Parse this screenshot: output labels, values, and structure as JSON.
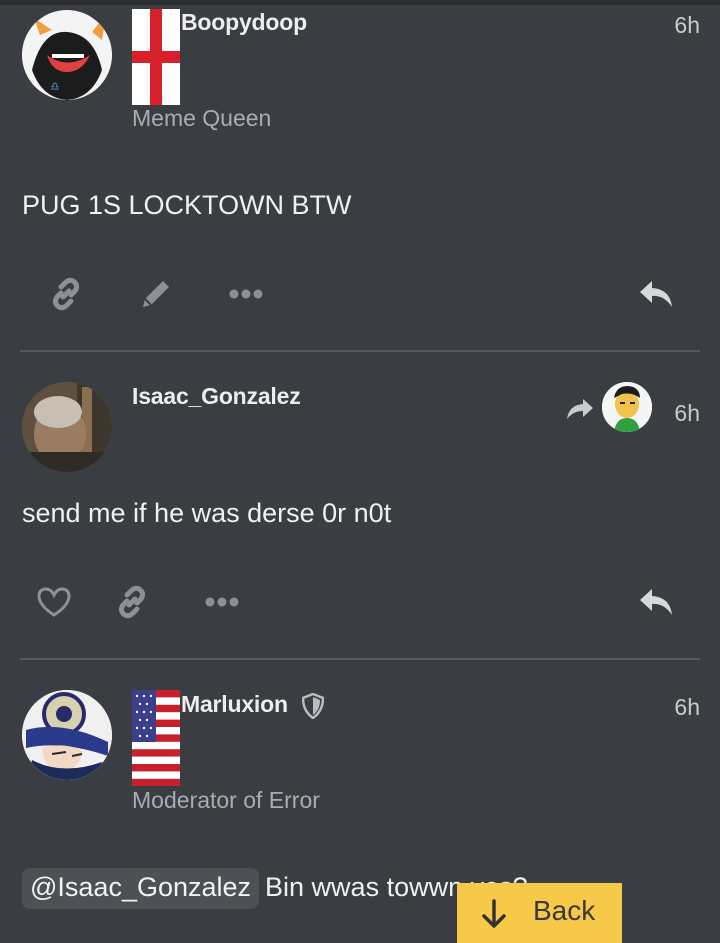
{
  "posts": [
    {
      "username": "Boopydoop",
      "user_title": "Meme Queen",
      "time": "6h",
      "body": "PUG 1S LOCKTOWN BTW",
      "flag": "england"
    },
    {
      "username": "Isaac_Gonzalez",
      "time": "6h",
      "body": "send me if he was derse 0r n0t",
      "reply_to_avatar": "green-shirt-avatar"
    },
    {
      "username": "Marluxion",
      "user_title": "Moderator of Error",
      "time": "6h",
      "mention": "@Isaac_Gonzalez",
      "body": "Bin wwas towwn yes?",
      "flag": "usa",
      "badge_icon": "shield-icon"
    }
  ],
  "back_button": {
    "label": "Back",
    "icon": "arrow-down-icon"
  },
  "colors": {
    "background": "#3a3d42",
    "accent_button": "#f7c948",
    "icon_gray": "#8d9196"
  }
}
